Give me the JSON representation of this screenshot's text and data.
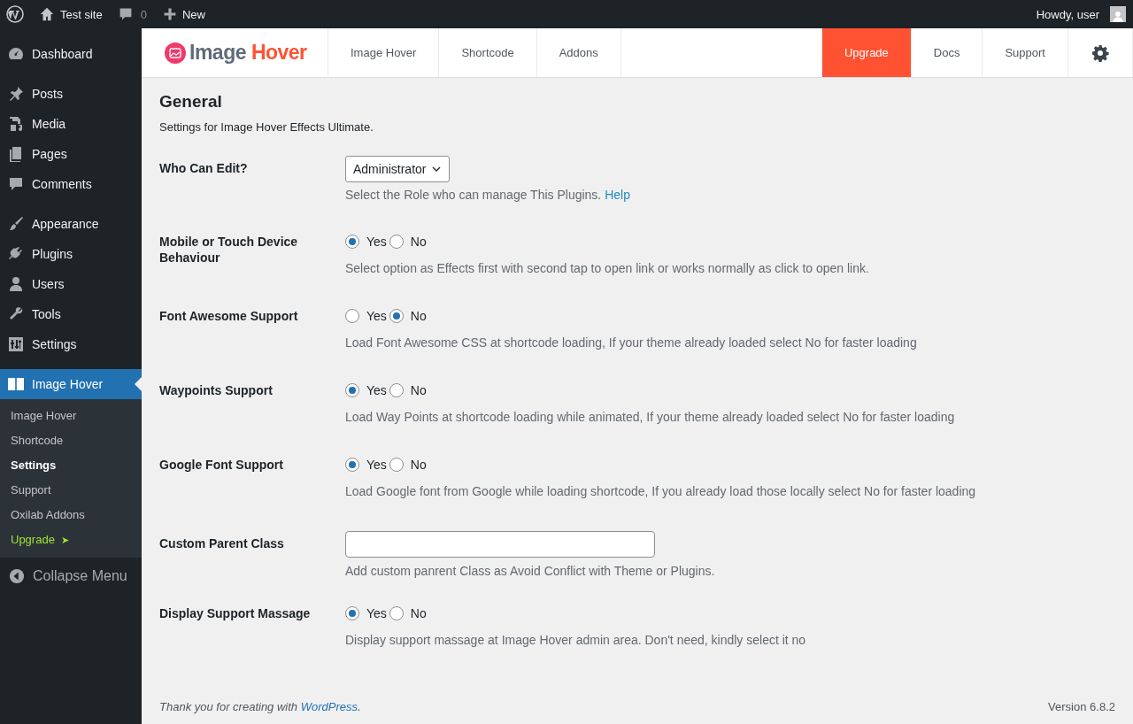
{
  "admin_bar": {
    "site": "Test site",
    "comments": "0",
    "new": "New",
    "greeting": "Howdy, user"
  },
  "sidebar": {
    "groups": [
      [
        {
          "label": "Dashboard",
          "selected": false
        }
      ],
      [
        {
          "label": "Posts",
          "selected": false
        },
        {
          "label": "Media",
          "selected": false
        },
        {
          "label": "Pages",
          "selected": false
        },
        {
          "label": "Comments",
          "selected": false
        }
      ],
      [
        {
          "label": "Appearance",
          "selected": false
        },
        {
          "label": "Plugins",
          "selected": false
        },
        {
          "label": "Users",
          "selected": false
        },
        {
          "label": "Tools",
          "selected": false
        },
        {
          "label": "Settings",
          "selected": false
        }
      ],
      [
        {
          "label": "Image Hover",
          "selected": true,
          "submenu": [
            {
              "label": "Image Hover",
              "selected": false,
              "kind": "link"
            },
            {
              "label": "Shortcode",
              "selected": false,
              "kind": "link"
            },
            {
              "label": "Settings",
              "selected": true,
              "kind": "link"
            },
            {
              "label": "Support",
              "selected": false,
              "kind": "link"
            },
            {
              "label": "Oxilab Addons",
              "selected": false,
              "kind": "link"
            },
            {
              "label": "Upgrade",
              "selected": false,
              "kind": "upgrade",
              "arrow": "➤"
            }
          ]
        }
      ]
    ],
    "collapse": "Collapse Menu"
  },
  "plugin_header": {
    "brand": [
      "Image",
      "Hover"
    ],
    "nav_left": [
      {
        "label": "Image Hover"
      },
      {
        "label": "Shortcode"
      },
      {
        "label": "Addons"
      }
    ],
    "nav_right": [
      {
        "kind": "upgrade",
        "label": "Upgrade"
      },
      {
        "kind": "link",
        "label": "Docs"
      },
      {
        "kind": "link",
        "label": "Support"
      },
      {
        "kind": "settings"
      }
    ]
  },
  "settings": {
    "title": "General",
    "subtitle": "Settings for Image Hover Effects Ultimate.",
    "rows": [
      {
        "kind": "select",
        "label": "Who Can Edit?",
        "value": "Administrator",
        "help": "Select the Role who can manage This Plugins.",
        "help_link": "Help"
      },
      {
        "kind": "radio",
        "label": "Mobile or Touch Device Behaviour",
        "options": [
          {
            "label": "Yes",
            "selected": true
          },
          {
            "label": "No",
            "selected": false
          }
        ],
        "help": "Select option as Effects first with second tap to open link or works normally as click to open link."
      },
      {
        "kind": "radio",
        "label": "Font Awesome Support",
        "options": [
          {
            "label": "Yes",
            "selected": false
          },
          {
            "label": "No",
            "selected": true
          }
        ],
        "help": "Load Font Awesome CSS at shortcode loading, If your theme already loaded select No for faster loading"
      },
      {
        "kind": "radio",
        "label": "Waypoints Support",
        "options": [
          {
            "label": "Yes",
            "selected": true
          },
          {
            "label": "No",
            "selected": false
          }
        ],
        "help": "Load Way Points at shortcode loading while animated, If your theme already loaded select No for faster loading"
      },
      {
        "kind": "radio",
        "label": "Google Font Support",
        "options": [
          {
            "label": "Yes",
            "selected": true
          },
          {
            "label": "No",
            "selected": false
          }
        ],
        "help": "Load Google font from Google while loading shortcode, If you already load those locally select No for faster loading"
      },
      {
        "kind": "text",
        "label": "Custom Parent Class",
        "help": "Add custom panrent Class as Avoid Conflict with Theme or Plugins."
      },
      {
        "kind": "radio",
        "label": "Display Support Massage",
        "options": [
          {
            "label": "Yes",
            "selected": true
          },
          {
            "label": "No",
            "selected": false
          }
        ],
        "help": "Display support massage at Image Hover admin area. Don't need, kindly select it no"
      }
    ]
  },
  "footer": {
    "before": "Thank you for creating with ",
    "link": "WordPress",
    "after": ".",
    "version": "Version 6.8.2"
  }
}
